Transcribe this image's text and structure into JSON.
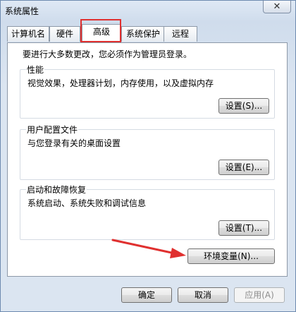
{
  "window": {
    "title": "系统属性",
    "close_glyph": "✕"
  },
  "tabs": [
    "计算机名",
    "硬件",
    "高级",
    "系统保护",
    "远程"
  ],
  "active_tab": "高级",
  "notice": "要进行大多数更改，您必须作为管理员登录。",
  "groups": {
    "performance": {
      "title": "性能",
      "desc": "视觉效果，处理器计划，内存使用，以及虚拟内存",
      "button": "设置(S)..."
    },
    "profiles": {
      "title": "用户配置文件",
      "desc": "与您登录有关的桌面设置",
      "button": "设置(E)..."
    },
    "startup": {
      "title": "启动和故障恢复",
      "desc": "系统启动、系统失败和调试信息",
      "button": "设置(T)..."
    }
  },
  "env_button": "环境变量(N)...",
  "footer": {
    "ok": "确定",
    "cancel": "取消",
    "apply": "应用(A)"
  },
  "annotation_color": "#e0302f"
}
